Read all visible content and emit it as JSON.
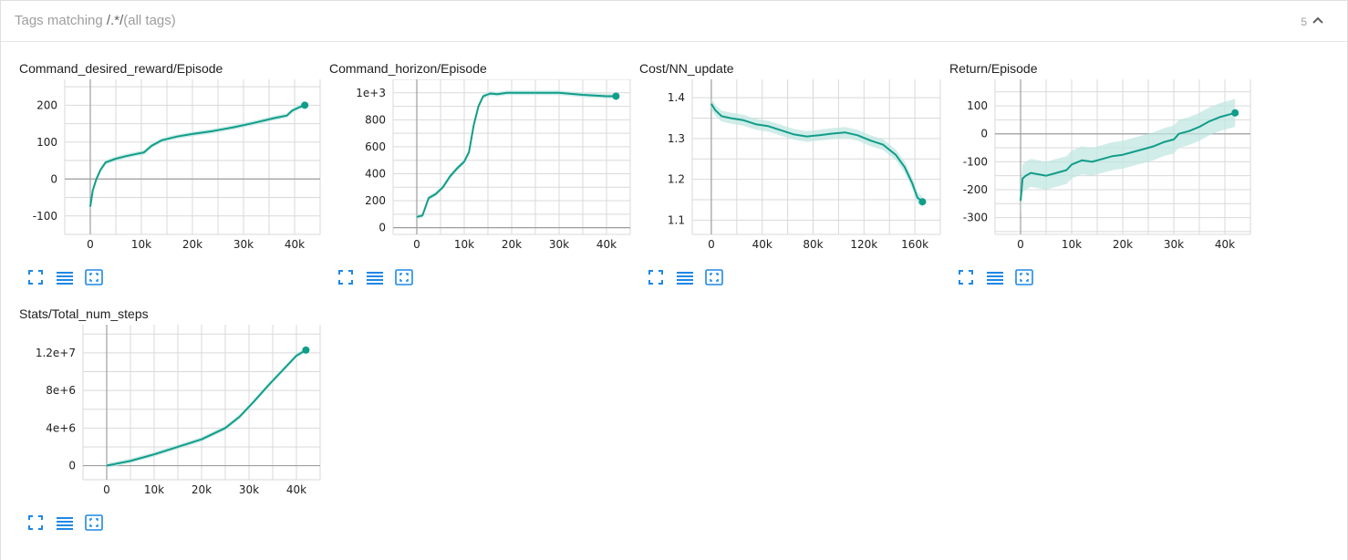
{
  "header": {
    "prefix": "Tags matching ",
    "regex": "/.*/",
    "suffix": "(all tags)",
    "count": "5"
  },
  "colors": {
    "series": "#109d8a",
    "series_raw": "#bde6df",
    "grid": "#d9d9d9",
    "axis": "#9e9e9e",
    "button": "#1e88e5"
  },
  "icons": {
    "expand": "expand-icon",
    "toggle_log": "list-lines-icon",
    "fit_domain": "fit-domain-icon",
    "collapse": "chevron-up-icon"
  },
  "chart_data": [
    {
      "title": "Command_desired_reward/Episode",
      "type": "line",
      "xlim": [
        -5000,
        45000
      ],
      "ylim": [
        -150,
        270
      ],
      "xticks": [
        0,
        10000,
        20000,
        30000,
        40000
      ],
      "xtick_labels": [
        "0",
        "10k",
        "20k",
        "30k",
        "40k"
      ],
      "yticks": [
        -100,
        0,
        100,
        200
      ],
      "ytick_labels": [
        "-100",
        "0",
        "100",
        "200"
      ],
      "series": [
        {
          "x": [
            0,
            500,
            1200,
            2000,
            3000,
            5000,
            7000,
            9000,
            10500,
            12000,
            14000,
            17000,
            20000,
            24000,
            28000,
            32000,
            36000,
            38500,
            39500,
            41000,
            42000
          ],
          "values": [
            -75,
            -30,
            0,
            25,
            45,
            55,
            62,
            68,
            72,
            90,
            105,
            115,
            122,
            130,
            140,
            152,
            165,
            172,
            185,
            195,
            200
          ]
        }
      ]
    },
    {
      "title": "Command_horizon/Episode",
      "type": "line",
      "xlim": [
        -5000,
        45000
      ],
      "ylim": [
        -50,
        1100
      ],
      "xticks": [
        0,
        10000,
        20000,
        30000,
        40000
      ],
      "xtick_labels": [
        "0",
        "10k",
        "20k",
        "30k",
        "40k"
      ],
      "yticks": [
        0,
        200,
        400,
        600,
        800,
        1000
      ],
      "ytick_labels": [
        "0",
        "200",
        "400",
        "600",
        "800",
        "1e+3"
      ],
      "series": [
        {
          "x": [
            0,
            1200,
            2500,
            4000,
            5500,
            7000,
            8500,
            10000,
            11000,
            12000,
            13000,
            14000,
            15500,
            17000,
            19000,
            25000,
            30000,
            35000,
            40000,
            42000
          ],
          "values": [
            80,
            90,
            220,
            250,
            300,
            380,
            440,
            490,
            560,
            760,
            900,
            975,
            995,
            990,
            1000,
            1000,
            1000,
            985,
            975,
            975
          ]
        }
      ]
    },
    {
      "title": "Cost/NN_update",
      "type": "line",
      "xlim": [
        -15000,
        180000
      ],
      "ylim": [
        1.065,
        1.445
      ],
      "xticks": [
        0,
        40000,
        80000,
        120000,
        160000
      ],
      "xtick_labels": [
        "0",
        "40k",
        "80k",
        "120k",
        "160k"
      ],
      "yticks": [
        1.1,
        1.2,
        1.3,
        1.4
      ],
      "ytick_labels": [
        "1.1",
        "1.2",
        "1.3",
        "1.4"
      ],
      "series": [
        {
          "x": [
            0,
            3000,
            8000,
            15000,
            25000,
            35000,
            45000,
            55000,
            65000,
            75000,
            85000,
            95000,
            105000,
            115000,
            125000,
            135000,
            145000,
            152000,
            158000,
            162000,
            166000
          ],
          "values": [
            1.385,
            1.37,
            1.355,
            1.35,
            1.345,
            1.335,
            1.33,
            1.32,
            1.31,
            1.305,
            1.308,
            1.312,
            1.315,
            1.308,
            1.295,
            1.285,
            1.26,
            1.23,
            1.19,
            1.155,
            1.145
          ]
        }
      ]
    },
    {
      "title": "Return/Episode",
      "type": "line",
      "xlim": [
        -5000,
        45000
      ],
      "ylim": [
        -360,
        195
      ],
      "xticks": [
        0,
        10000,
        20000,
        30000,
        40000
      ],
      "xtick_labels": [
        "0",
        "10k",
        "20k",
        "30k",
        "40k"
      ],
      "yticks": [
        -300,
        -200,
        -100,
        0,
        100
      ],
      "ytick_labels": [
        "-300",
        "-200",
        "-100",
        "0",
        "100"
      ],
      "series": [
        {
          "x": [
            0,
            400,
            1000,
            2000,
            3500,
            5000,
            7000,
            9000,
            10000,
            12000,
            14000,
            16000,
            18000,
            20000,
            22000,
            24000,
            26000,
            28000,
            30000,
            31000,
            33000,
            35000,
            37000,
            39000,
            41000,
            42000
          ],
          "values": [
            -240,
            -160,
            -150,
            -140,
            -145,
            -150,
            -140,
            -130,
            -110,
            -95,
            -100,
            -90,
            -80,
            -75,
            -65,
            -55,
            -45,
            -30,
            -20,
            0,
            10,
            25,
            45,
            60,
            70,
            75
          ]
        }
      ]
    },
    {
      "title": "Stats/Total_num_steps",
      "type": "line",
      "xlim": [
        -5000,
        45000
      ],
      "ylim": [
        -1500000,
        15000000
      ],
      "xticks": [
        0,
        10000,
        20000,
        30000,
        40000
      ],
      "xtick_labels": [
        "0",
        "10k",
        "20k",
        "30k",
        "40k"
      ],
      "yticks": [
        0,
        4000000,
        8000000,
        12000000
      ],
      "ytick_labels": [
        "0",
        "4e+6",
        "8e+6",
        "1.2e+7"
      ],
      "series": [
        {
          "x": [
            0,
            5000,
            10000,
            15000,
            20000,
            25000,
            28000,
            31000,
            34000,
            37000,
            40000,
            42000
          ],
          "values": [
            0,
            500000,
            1200000,
            2000000,
            2800000,
            4000000,
            5200000,
            6800000,
            8500000,
            10100000,
            11700000,
            12300000
          ]
        }
      ]
    }
  ]
}
